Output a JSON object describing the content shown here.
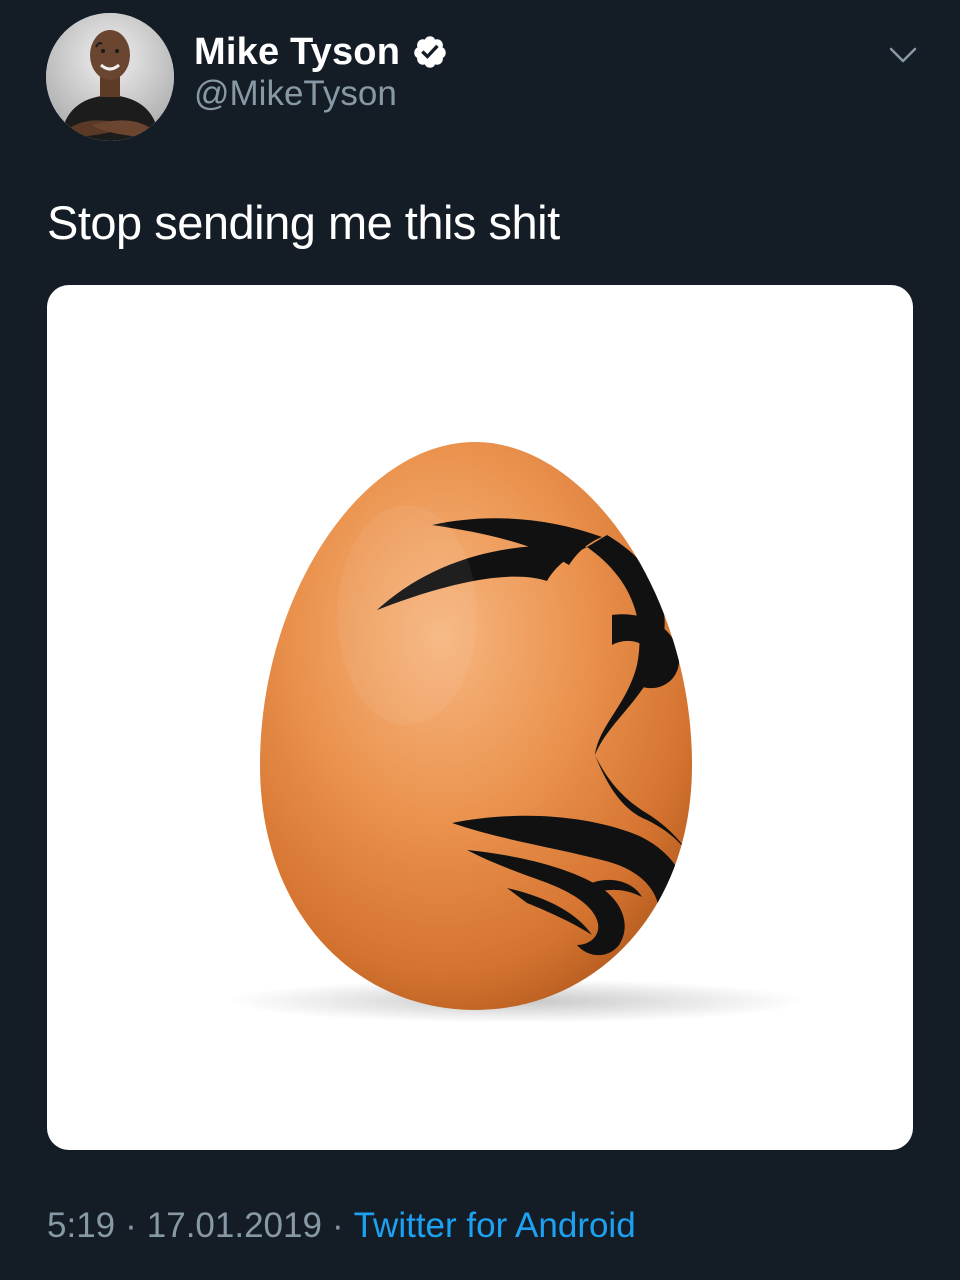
{
  "tweet": {
    "author": {
      "display_name": "Mike Tyson",
      "handle": "@MikeTyson",
      "verified": true,
      "avatar_icon": "profile-photo"
    },
    "text": "Stop sending me this shit",
    "media": {
      "description_icon": "egg-with-tribal-tattoo-photo"
    },
    "meta": {
      "time": "5:19",
      "separator": "·",
      "date": "17.01.2019",
      "source": "Twitter for Android"
    },
    "menu_icon": "chevron-down-icon"
  },
  "colors": {
    "background": "#141d26",
    "text": "#ffffff",
    "secondary_text": "#8899a6",
    "link": "#1da1f2",
    "verified_badge": "#ffffff"
  }
}
